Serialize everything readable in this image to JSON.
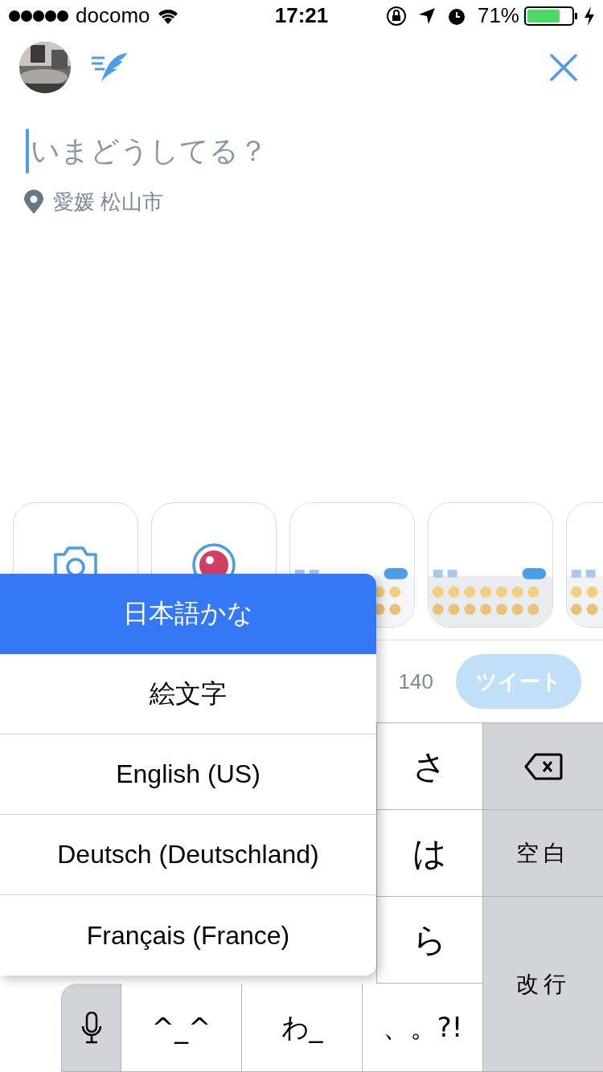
{
  "status_bar": {
    "carrier": "docomo",
    "time": "17:21",
    "battery": "71%"
  },
  "compose": {
    "placeholder": "いまどうしてる？",
    "location": "愛媛 松山市"
  },
  "media_strip": [
    {
      "kind": "camera"
    },
    {
      "kind": "live"
    },
    {
      "kind": "picture"
    },
    {
      "kind": "picture"
    },
    {
      "kind": "picture"
    }
  ],
  "toolbar": {
    "count": "140",
    "tweet_button": {
      "label": "ツイート",
      "disabled": true
    }
  },
  "keyboard": {
    "keys": [
      {
        "kind": "char",
        "label": "さ"
      },
      {
        "kind": "backspace"
      },
      {
        "kind": "char",
        "label": "は"
      },
      {
        "kind": "action",
        "label": "空白"
      },
      {
        "kind": "char",
        "label": "ら"
      },
      {
        "kind": "action",
        "label": "改行"
      },
      {
        "kind": "mic"
      },
      {
        "kind": "char",
        "label": "^_^"
      },
      {
        "kind": "char",
        "label": "わ_"
      },
      {
        "kind": "char",
        "label": "、。?!"
      }
    ]
  },
  "language_menu": [
    {
      "label": "日本語かな",
      "selected": true
    },
    {
      "label": "絵文字",
      "selected": false
    },
    {
      "label": "English (US)",
      "selected": false
    },
    {
      "label": "Deutsch (Deutschland)",
      "selected": false
    },
    {
      "label": "Français (France)",
      "selected": false
    }
  ]
}
